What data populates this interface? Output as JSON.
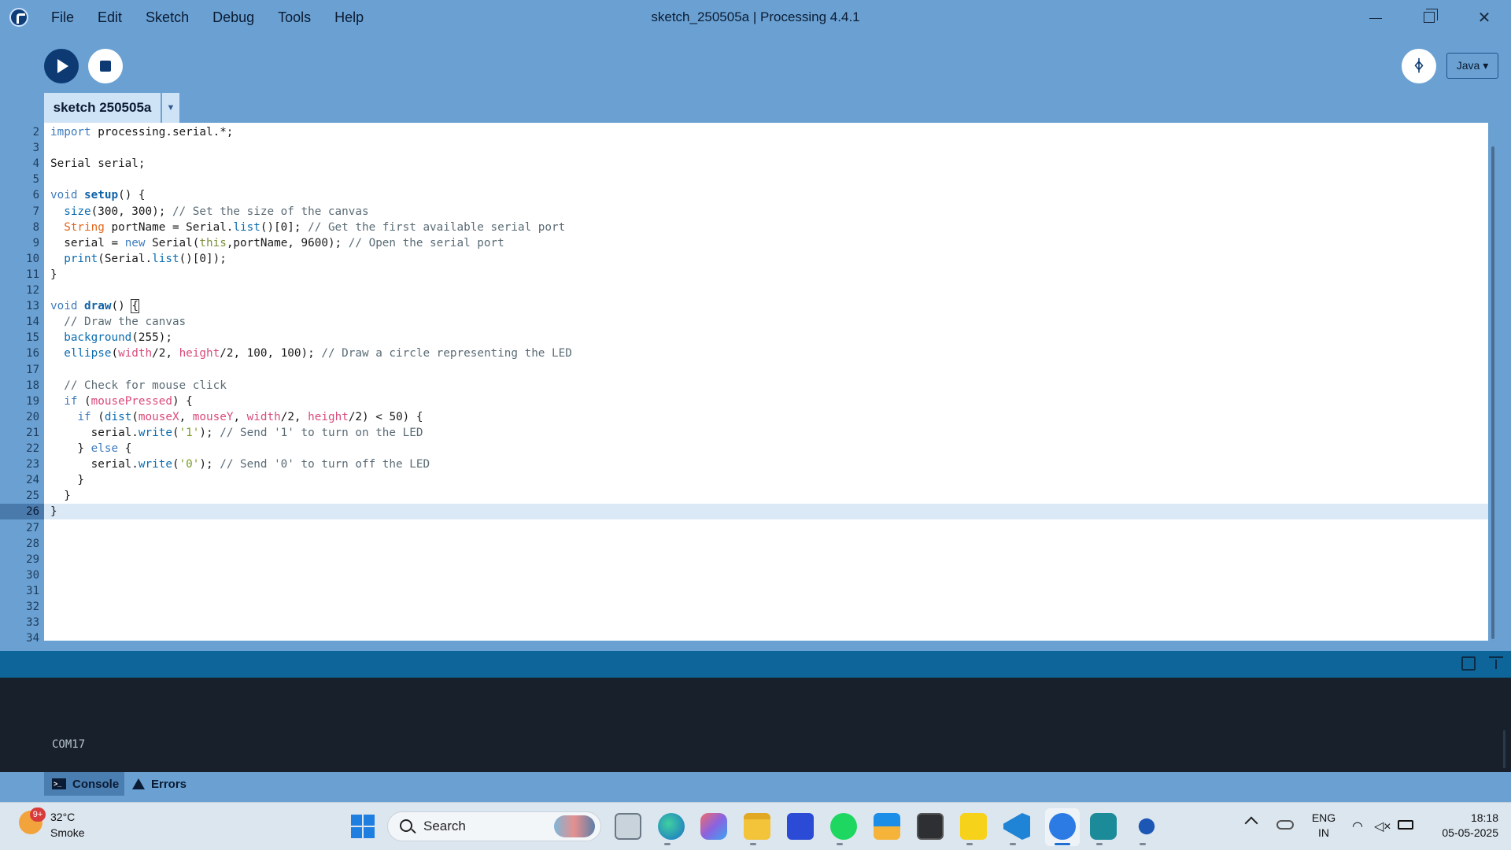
{
  "window": {
    "title": "sketch_250505a | Processing 4.4.1"
  },
  "menu": [
    "File",
    "Edit",
    "Sketch",
    "Debug",
    "Tools",
    "Help"
  ],
  "toolbar": {
    "mode_label": "Java ▾",
    "debugger_glyph": "ᛄ"
  },
  "tabs": {
    "sketch_label": "sketch 250505a",
    "menu_glyph": "▼"
  },
  "editor": {
    "current_line": 26,
    "line_numbers": [
      "2",
      "3",
      "4",
      "5",
      "6",
      "7",
      "8",
      "9",
      "10",
      "11",
      "12",
      "13",
      "14",
      "15",
      "16",
      "17",
      "18",
      "19",
      "20",
      "21",
      "22",
      "23",
      "24",
      "25",
      "26",
      "27",
      "28",
      "29",
      "30",
      "31",
      "32",
      "33",
      "34"
    ],
    "code": [
      "import processing.serial.*;",
      "",
      "Serial serial;",
      "",
      "void setup() {",
      "  size(300, 300); // Set the size of the canvas",
      "  String portName = Serial.list()[0]; // Get the first available serial port",
      "  serial = new Serial(this,portName, 9600); // Open the serial port",
      "  print(Serial.list()[0]);",
      "}",
      "",
      "void draw() {",
      "  // Draw the canvas",
      "  background(255);",
      "  ellipse(width/2, height/2, 100, 100); // Draw a circle representing the LED",
      "",
      "  // Check for mouse click",
      "  if (mousePressed) {",
      "    if (dist(mouseX, mouseY, width/2, height/2) < 50) {",
      "      serial.write('1'); // Send '1' to turn on the LED",
      "    } else {",
      "      serial.write('0'); // Send '0' to turn off the LED",
      "    }",
      "  }",
      "}"
    ]
  },
  "console": {
    "output": "COM17",
    "tab_console": "Console",
    "tab_errors": "Errors"
  },
  "taskbar": {
    "weather_badge": "9+",
    "weather_temp": "32°C",
    "weather_desc": "Smoke",
    "search_label": "Search",
    "lang_line1": "ENG",
    "lang_line2": "IN",
    "time": "18:18",
    "date": "05-05-2025"
  },
  "colors": {
    "chrome": "#6aa1d2",
    "run_button": "#0d3a73",
    "console_bg": "#17202b",
    "console_header": "#0e6599"
  }
}
